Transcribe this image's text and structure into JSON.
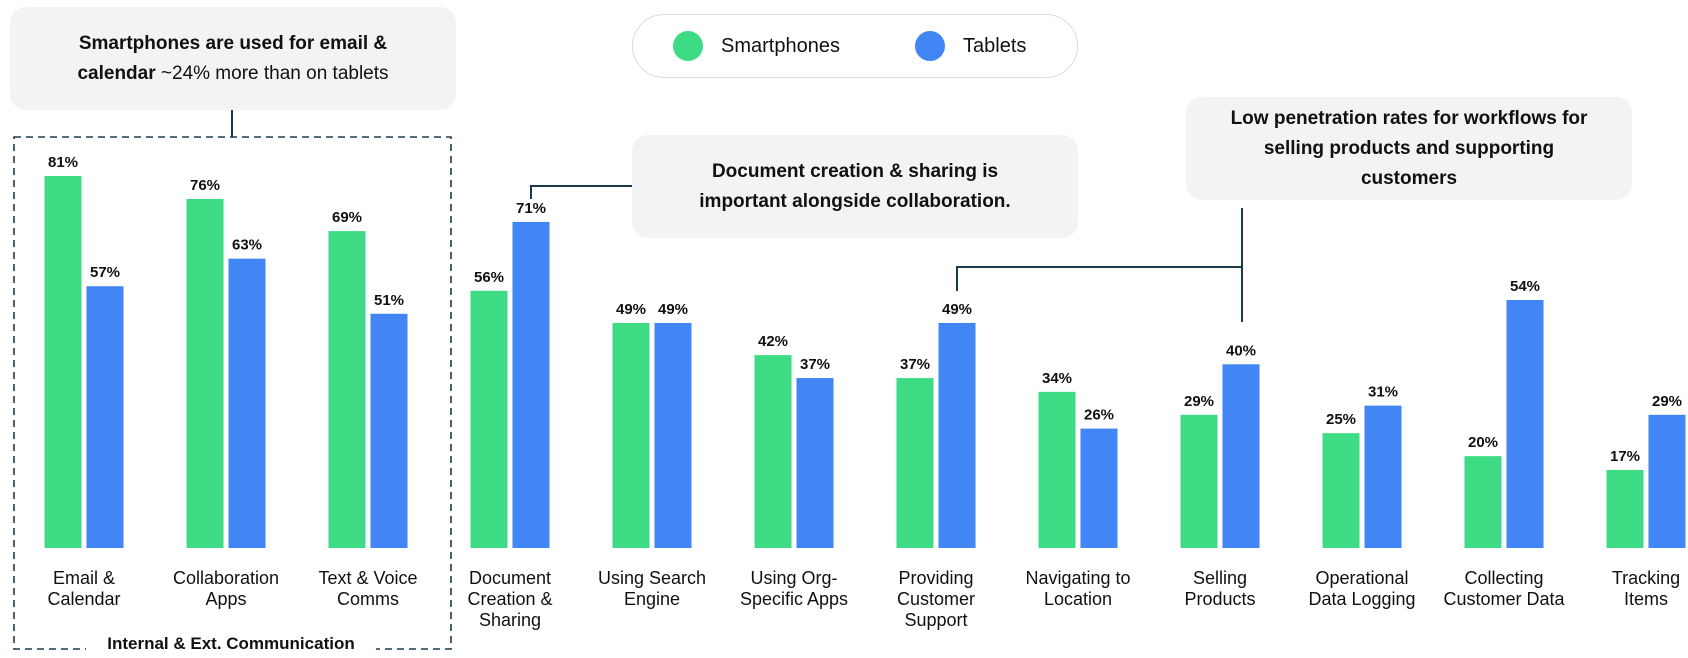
{
  "legend": {
    "smartphones": "Smartphones",
    "tablets": "Tablets"
  },
  "colors": {
    "smartphones": "#3ddc84",
    "tablets": "#4285f4",
    "connector": "#1b3a4b",
    "callout_bg": "#f1f3f4"
  },
  "callouts": {
    "email_bold": "Smartphones are used for email &",
    "email_bold2": "calendar",
    "email_rest": " ~24% more than on tablets",
    "document": "Document creation & sharing is important alongside collaboration.",
    "selling": "Low penetration rates for workflows for selling products and supporting customers"
  },
  "group_label": "Internal & Ext. Communication",
  "chart_data": {
    "type": "bar",
    "categories": [
      [
        "Email &",
        "Calendar"
      ],
      [
        "Collaboration",
        "Apps"
      ],
      [
        "Text & Voice",
        "Comms"
      ],
      [
        "Document",
        "Creation &",
        "Sharing"
      ],
      [
        "Using Search",
        "Engine"
      ],
      [
        "Using Org-",
        "Specific Apps"
      ],
      [
        "Providing",
        "Customer",
        "Support"
      ],
      [
        "Navigating to",
        "Location"
      ],
      [
        "Selling",
        "Products"
      ],
      [
        "Operational",
        "Data Logging"
      ],
      [
        "Collecting",
        "Customer Data"
      ],
      [
        "Tracking",
        "Items"
      ]
    ],
    "series": [
      {
        "name": "Smartphones",
        "values": [
          81,
          76,
          69,
          56,
          49,
          42,
          37,
          34,
          29,
          25,
          20,
          17
        ]
      },
      {
        "name": "Tablets",
        "values": [
          57,
          63,
          51,
          71,
          49,
          37,
          49,
          26,
          40,
          31,
          54,
          29
        ]
      }
    ],
    "value_labels": {
      "Smartphones": [
        "81%",
        "76%",
        "69%",
        "56%",
        "49%",
        "42%",
        "37%",
        "34%",
        "29%",
        "25%",
        "20%",
        "17%"
      ],
      "Tablets": [
        "57%",
        "63%",
        "51%",
        "71%",
        "49%",
        "37%",
        "49%",
        "26%",
        "40%",
        "31%",
        "54%",
        "29%"
      ]
    },
    "ylim": [
      0,
      81
    ],
    "grid": false,
    "legend_position": "top-center"
  }
}
